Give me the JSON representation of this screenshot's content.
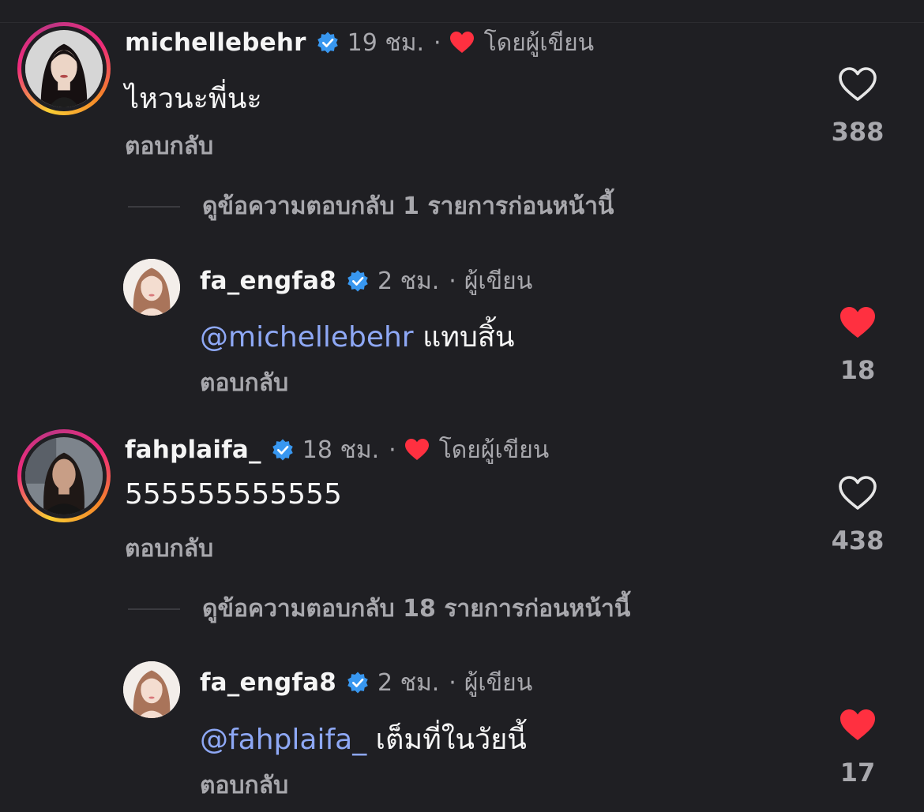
{
  "colors": {
    "background": "#1f1f23",
    "text_primary": "#f5f5f5",
    "text_secondary": "#a8a8ad",
    "mention": "#8ea8f5",
    "verified": "#3897f0",
    "like_red": "#ff3040"
  },
  "comments": [
    {
      "username": "michellebehr",
      "verified": true,
      "time": "19 ชม.",
      "dot": "·",
      "liked_by_author": true,
      "author_label": "โดยผู้เขียน",
      "text": "ไหวนะพี่นะ",
      "reply_label": "ตอบกลับ",
      "likes": "388",
      "liked": false,
      "view_replies": "ดูข้อความตอบกลับ 1 รายการก่อนหน้านี้",
      "reply": {
        "username": "fa_engfa8",
        "verified": true,
        "time": "2 ชม.",
        "dot": "·",
        "author_label": "ผู้เขียน",
        "mention": "@michellebehr",
        "text": "แทบสิ้น",
        "reply_label": "ตอบกลับ",
        "likes": "18",
        "liked": true
      }
    },
    {
      "username": "fahplaifa_",
      "verified": true,
      "time": "18 ชม.",
      "dot": "·",
      "liked_by_author": true,
      "author_label": "โดยผู้เขียน",
      "text": "555555555555",
      "reply_label": "ตอบกลับ",
      "likes": "438",
      "liked": false,
      "view_replies": "ดูข้อความตอบกลับ 18 รายการก่อนหน้านี้",
      "reply": {
        "username": "fa_engfa8",
        "verified": true,
        "time": "2 ชม.",
        "dot": "·",
        "author_label": "ผู้เขียน",
        "mention": "@fahplaifa_",
        "text": "เต็มที่ในวัยนี้",
        "reply_label": "ตอบกลับ",
        "likes": "17",
        "liked": true
      }
    }
  ],
  "icons": {
    "verified": "verified-badge-icon",
    "heart_outline": "heart-outline-icon",
    "heart_filled": "heart-filled-icon"
  }
}
